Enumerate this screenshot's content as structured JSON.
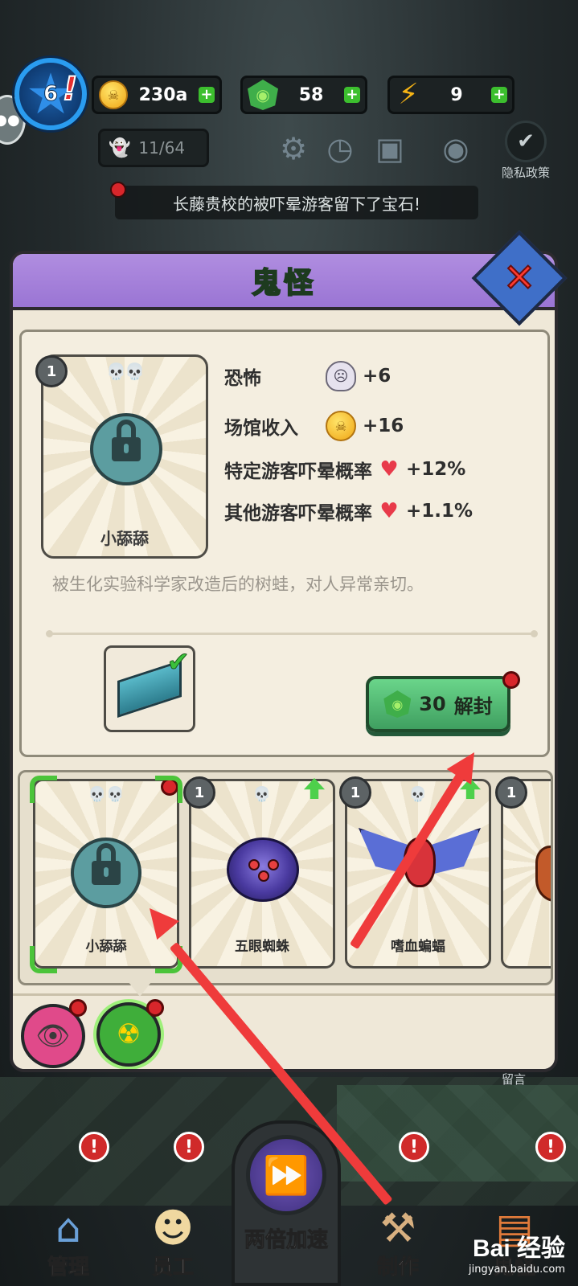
{
  "hud": {
    "level": "6",
    "level_alert": "!",
    "coins": "230a",
    "gems": "58",
    "energy": "9",
    "ghost_count": "11/64",
    "privacy_label": "隐私政策",
    "notice": "长藤贵校的被吓晕游客留下了宝石!"
  },
  "panel": {
    "title": "鬼怪",
    "selected": {
      "level": "1",
      "name": "小舔舔",
      "stats": [
        {
          "label": "恐怖",
          "value": "+6",
          "icon": "skull-icon"
        },
        {
          "label": "场馆收入",
          "value": "+16",
          "icon": "coin-icon"
        },
        {
          "label": "特定游客吓晕概率",
          "value": "+12%",
          "icon": "heartbeat-icon"
        },
        {
          "label": "其他游客吓晕概率",
          "value": "+1.1%",
          "icon": "heartbeat-icon"
        }
      ],
      "description": "被生化实验科学家改造后的树蛙，对人异常亲切。",
      "unlock_cost": "30",
      "unlock_label": "解封"
    },
    "gallery": [
      {
        "name": "小舔舔",
        "level": "",
        "locked": true,
        "skulls": 2
      },
      {
        "name": "五眼蜘蛛",
        "level": "1",
        "locked": false,
        "skulls": 1
      },
      {
        "name": "嗜血蝙蝠",
        "level": "1",
        "locked": false,
        "skulls": 1
      },
      {
        "name": "",
        "level": "1",
        "locked": false,
        "skulls": 0
      }
    ]
  },
  "side": {
    "message_label": "留言"
  },
  "nav": {
    "manage": "管理",
    "staff": "员工",
    "speed": "两倍加速",
    "craft": "制作",
    "ghosts": "鬼怪"
  },
  "watermark": {
    "logo": "Bai 经验",
    "sub": "jingyan.baidu.com"
  },
  "colors": {
    "accent_purple": "#9a75d4",
    "unlock_green": "#3f9f60",
    "alert_red": "#d8262b",
    "arrow_red": "#ef3b3b"
  }
}
